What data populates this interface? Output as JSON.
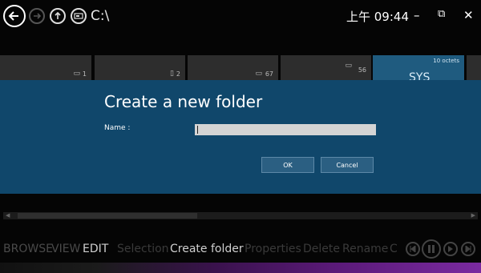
{
  "top_bar": {
    "path": "C:\\",
    "clock": "上午 09:44",
    "minimize_glyph": "–",
    "restore_glyph": "⧉",
    "close_glyph": "✕"
  },
  "tiles": [
    {
      "count": "1",
      "icon": "folder-icon"
    },
    {
      "count": "2",
      "icon": "file-icon"
    },
    {
      "count": "67",
      "icon": "folder-icon"
    },
    {
      "count": "",
      "icon": "folder-icon"
    },
    {
      "count": "56",
      "icon": "folder-icon"
    },
    {
      "size": "10 octets",
      "name": "SYS",
      "icon": "file-icon"
    }
  ],
  "dialog": {
    "title": "Create a new folder",
    "name_label": "Name :",
    "name_value": "",
    "ok_label": "OK",
    "cancel_label": "Cancel"
  },
  "command_bar": {
    "browse": "BROWSE",
    "view": "VIEW",
    "edit": "EDIT",
    "selection": "Selection",
    "create_folder": "Create folder",
    "properties": "Properties",
    "delete": "Delete",
    "rename": "Rename",
    "more": "C"
  },
  "colors": {
    "dialog_bg": "#10476b",
    "button_bg": "#2b5f82",
    "accent_tile": "#1f5b7f"
  }
}
